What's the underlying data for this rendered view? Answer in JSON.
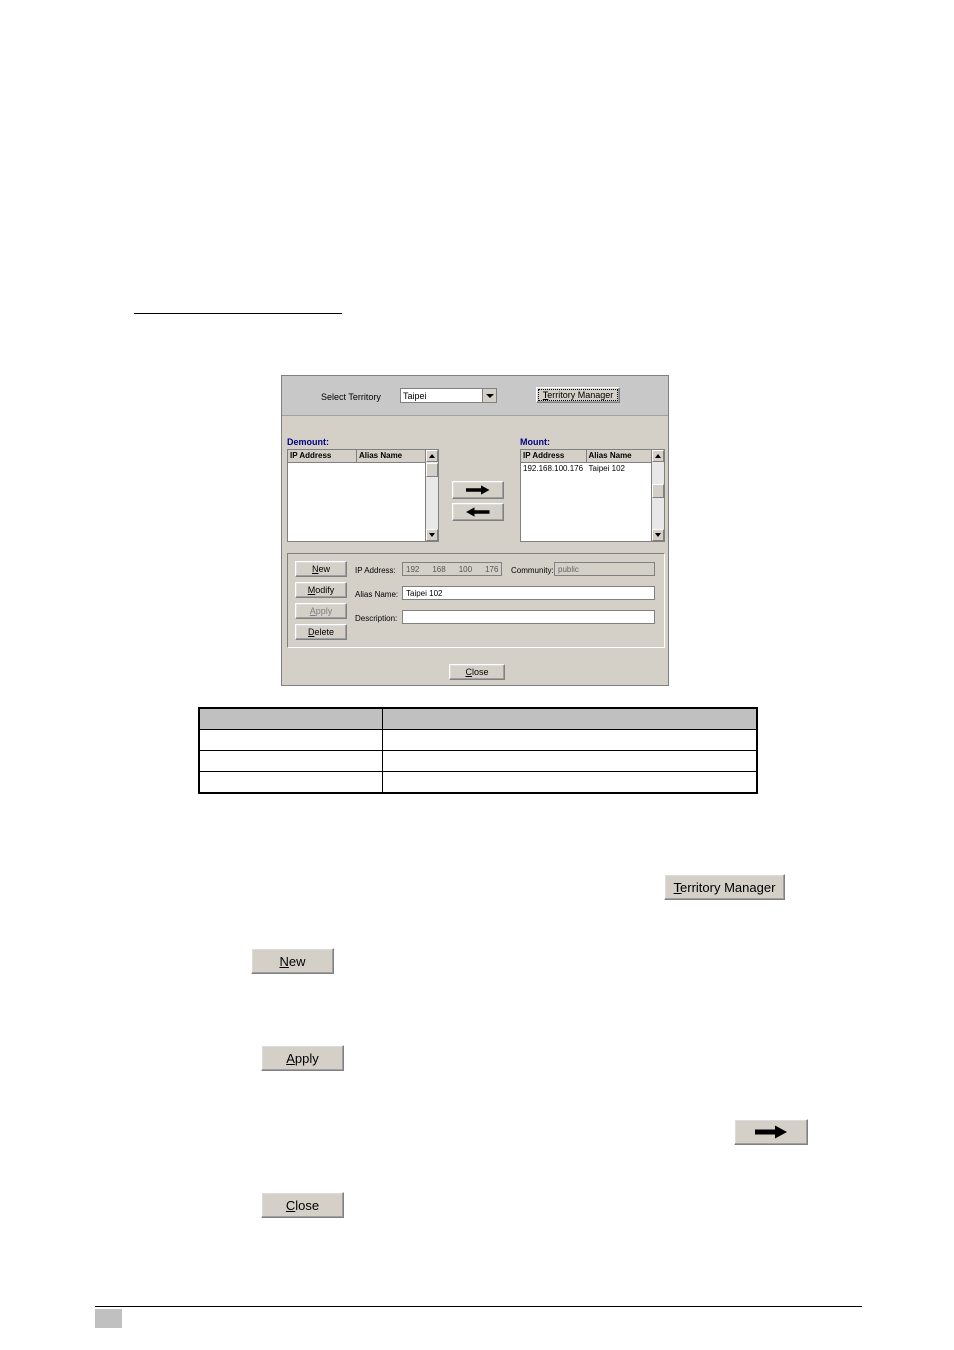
{
  "dialog": {
    "select_territory_label": "Select Territory",
    "territory_value": "Taipei",
    "territory_manager_button": "Territory Manager",
    "demount_label": "Demount:",
    "mount_label": "Mount:",
    "columns": {
      "ip_address": "IP Address",
      "alias_name": "Alias Name"
    },
    "demount_rows": [],
    "mount_rows": [
      {
        "ip": "192.168.100.176",
        "alias": "Taipei 102"
      }
    ],
    "move_right_icon": "arrow-right-icon",
    "move_left_icon": "arrow-left-icon",
    "buttons": {
      "new": "New",
      "modify": "Modify",
      "apply": "Apply",
      "delete": "Delete",
      "close": "Close"
    },
    "form": {
      "ip_address_label": "IP Address:",
      "ip_octets": [
        "192",
        "168",
        "100",
        "176"
      ],
      "community_label": "Community:",
      "community_value": "public",
      "alias_name_label": "Alias Name:",
      "alias_name_value": "Taipei 102",
      "description_label": "Description:",
      "description_value": ""
    }
  },
  "doc_table": {
    "rows": [
      {
        "c1": "",
        "c2": ""
      },
      {
        "c1": "",
        "c2": ""
      },
      {
        "c1": "",
        "c2": ""
      },
      {
        "c1": "",
        "c2": ""
      }
    ]
  },
  "inline_buttons": {
    "territory_manager": "Territory Manager",
    "new": "New",
    "apply": "Apply",
    "arrow_right": "arrow-right-icon",
    "close": "Close"
  }
}
